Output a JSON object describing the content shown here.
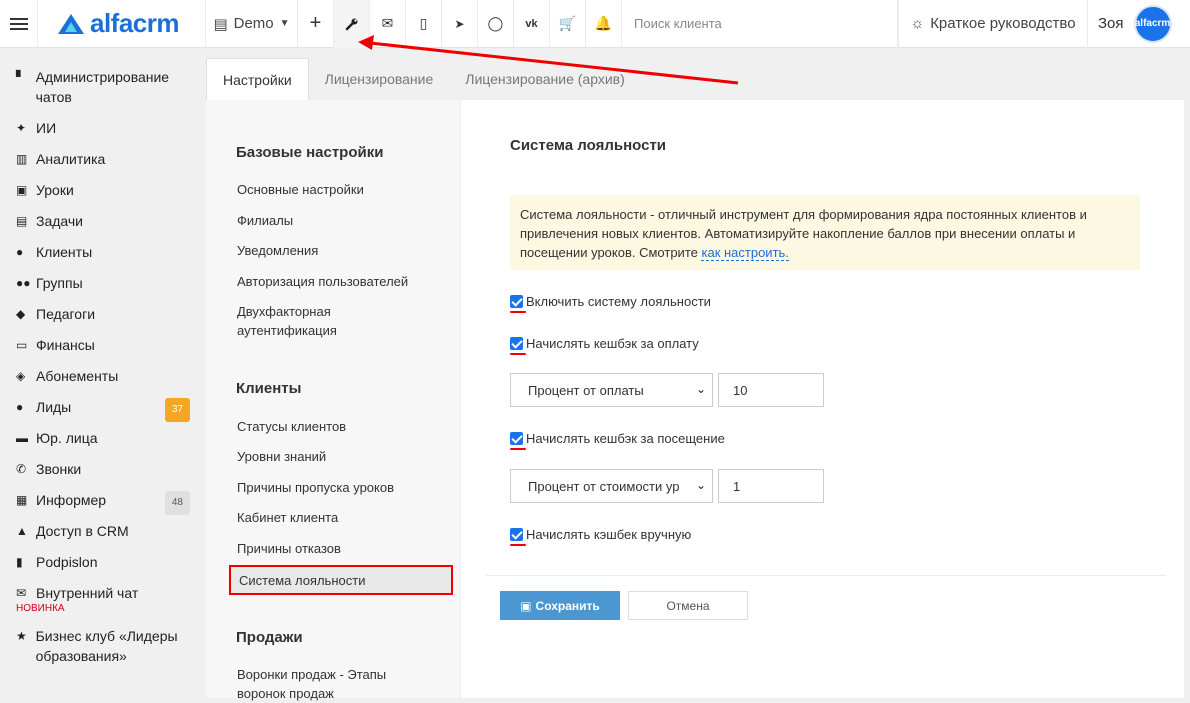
{
  "header": {
    "logo_text": "alfacrm",
    "branch": "Demo",
    "search_placeholder": "Поиск клиента",
    "guide_label": "Краткое руководство",
    "user_name": "Зоя",
    "avatar_text": "alfacrm"
  },
  "sidebar": {
    "items": [
      {
        "label": "Администрирование чатов",
        "icon": "admin-chats-icon"
      },
      {
        "label": "ИИ",
        "icon": "ai-sparkle-icon"
      },
      {
        "label": "Аналитика",
        "icon": "analytics-map-icon"
      },
      {
        "label": "Уроки",
        "icon": "calendar-icon"
      },
      {
        "label": "Задачи",
        "icon": "clipboard-icon"
      },
      {
        "label": "Клиенты",
        "icon": "user-icon"
      },
      {
        "label": "Группы",
        "icon": "users-icon"
      },
      {
        "label": "Педагоги",
        "icon": "teacher-icon"
      },
      {
        "label": "Финансы",
        "icon": "money-icon"
      },
      {
        "label": "Абонементы",
        "icon": "tag-icon"
      },
      {
        "label": "Лиды",
        "icon": "user-plus-icon",
        "badge": "37"
      },
      {
        "label": "Юр. лица",
        "icon": "briefcase-icon"
      },
      {
        "label": "Звонки",
        "icon": "phone-icon"
      },
      {
        "label": "Информер",
        "icon": "inbox-icon",
        "badge": "48"
      },
      {
        "label": "Доступ в CRM",
        "icon": "lock-icon"
      },
      {
        "label": "Podpislon",
        "icon": "document-icon"
      },
      {
        "label": "Внутренний чат",
        "icon": "mail-icon",
        "sub": "НОВИНКА"
      },
      {
        "label": "Бизнес клуб «Лидеры образования»",
        "icon": "star-icon"
      }
    ],
    "badge_colors": {
      "leads": "#f5a623",
      "informer": "#e0e0e0"
    }
  },
  "tabs": [
    "Настройки",
    "Лицензирование",
    "Лицензирование (архив)"
  ],
  "menu": {
    "section_basic": "Базовые настройки",
    "basic_items": [
      "Основные настройки",
      "Филиалы",
      "Уведомления",
      "Авторизация пользователей",
      "Двухфакторная аутентификация"
    ],
    "section_clients": "Клиенты",
    "client_items": [
      "Статусы клиентов",
      "Уровни знаний",
      "Причины пропуска уроков",
      "Кабинет клиента",
      "Причины отказов",
      "Система лояльности"
    ],
    "section_sales": "Продажи",
    "sales_items": [
      "Воронки продаж - Этапы воронок продаж"
    ]
  },
  "content": {
    "title": "Система лояльности",
    "info_text": "Система лояльности - отличный инструмент для формирования ядра постоянных клиентов и привлечения новых клиентов. Автоматизируйте накопление баллов при внесении оплаты и посещении уроков. Смотрите",
    "info_link": "как настроить.",
    "cb_enable": "Включить систему лояльности",
    "cb_payment": "Начислять кешбэк за оплату",
    "select_payment": "Процент от оплаты",
    "value_payment": "10",
    "cb_visit": "Начислять кешбэк за посещение",
    "select_visit": "Процент от стоимости ур",
    "value_visit": "1",
    "cb_manual": "Начислять кэшбек вручную",
    "save_label": "Сохранить",
    "cancel_label": "Отмена"
  },
  "colors": {
    "accent": "#1a73e8",
    "save_button": "#4a97d1",
    "highlight": "#e00000",
    "info_bg": "#fdf8e1"
  }
}
